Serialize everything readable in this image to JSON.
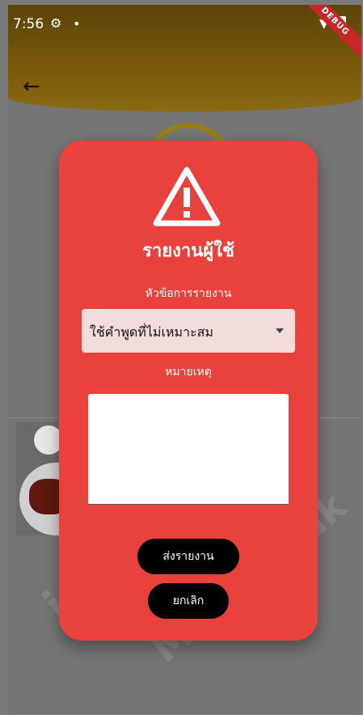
{
  "status_bar": {
    "time": "7:56",
    "debug_banner": "DEBUG"
  },
  "dialog": {
    "title": "รายงานผู้ใช้",
    "topic_label": "หัวข้อการรายงาน",
    "topic_selected": "ใช้คำพูดที่ไม่เหมาะสม",
    "note_label": "หมายเหตุ",
    "note_value": "",
    "submit_label": "ส่งรายงาน",
    "cancel_label": "ยกเลิก"
  },
  "watermark": {
    "line1": "ience Depa",
    "line2": "Mahasarak"
  },
  "colors": {
    "dialog_bg": "#e9423c",
    "button_bg": "#000000",
    "header_bg": "#7a5a0a"
  },
  "icons": {
    "back": "arrow-left-icon",
    "warning": "warning-triangle-icon"
  }
}
